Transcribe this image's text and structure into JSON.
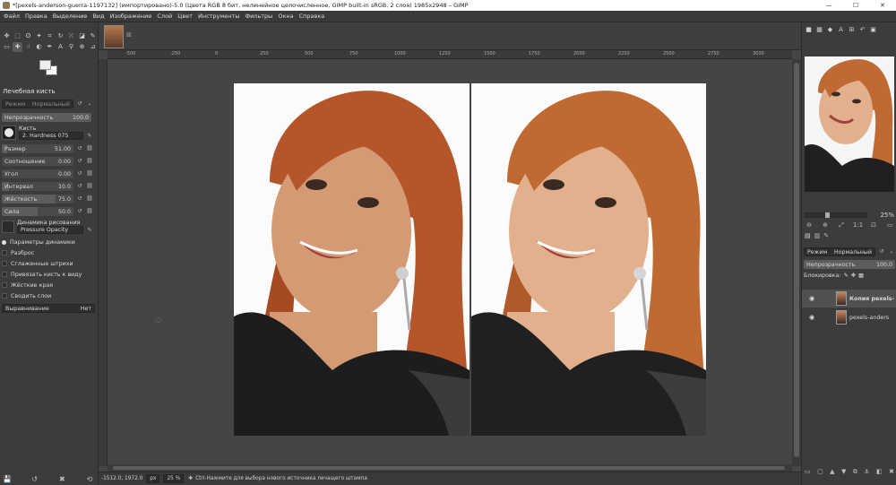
{
  "window": {
    "title": "*[pexels-anderson-guerra-1197132] (импортировано)-5.0 (Цвета RGB 8 бит, нелинейное целочисленное, GIMP built-in sRGB, 2 слоя) 1985x2948 – GIMP",
    "minimize": "—",
    "maximize": "☐",
    "close": "✕"
  },
  "menu": [
    "Файл",
    "Правка",
    "Выделение",
    "Вид",
    "Изображение",
    "Слой",
    "Цвет",
    "Инструменты",
    "Фильтры",
    "Окна",
    "Справка"
  ],
  "toolbox": {
    "tools": [
      {
        "icon": "move-icon",
        "glyph": "✥",
        "active": false
      },
      {
        "icon": "rect-select-icon",
        "glyph": "⬚",
        "active": false
      },
      {
        "icon": "lasso-icon",
        "glyph": "ʘ",
        "active": false
      },
      {
        "icon": "fuzzy-select-icon",
        "glyph": "✦",
        "active": false
      },
      {
        "icon": "crop-icon",
        "glyph": "⌗",
        "active": false
      },
      {
        "icon": "rotate-icon",
        "glyph": "↻",
        "active": false
      },
      {
        "icon": "warp-icon",
        "glyph": "⤫",
        "active": false
      },
      {
        "icon": "bucket-fill-icon",
        "glyph": "◪",
        "active": false
      },
      {
        "icon": "paintbrush-icon",
        "glyph": "✎",
        "active": false
      },
      {
        "icon": "eraser-icon",
        "glyph": "▭",
        "active": false
      },
      {
        "icon": "heal-icon",
        "glyph": "✚",
        "active": true
      },
      {
        "icon": "smudge-icon",
        "glyph": "☝",
        "active": false
      },
      {
        "icon": "dodge-icon",
        "glyph": "◐",
        "active": false
      },
      {
        "icon": "path-icon",
        "glyph": "✒",
        "active": false
      },
      {
        "icon": "text-icon",
        "glyph": "A",
        "active": false
      },
      {
        "icon": "color-picker-icon",
        "glyph": "⚲",
        "active": false
      },
      {
        "icon": "zoom-icon",
        "glyph": "⊕",
        "active": false
      },
      {
        "icon": "measure-icon",
        "glyph": "⊿",
        "active": false
      }
    ],
    "options_title": "Лечебная кисть",
    "mode_label": "Режим",
    "mode_value": "Нормальный",
    "opacity_label": "Непрозрачность",
    "opacity_value": "100.0",
    "brush_label": "Кисть",
    "brush_value": "2. Hardness 075",
    "size_label": "Размер",
    "size_value": "51.00",
    "aspect_label": "Соотношение",
    "aspect_value": "0.00",
    "angle_label": "Угол",
    "angle_value": "0.00",
    "spacing_label": "Интервал",
    "spacing_value": "10.0",
    "hardness_label": "Жёсткость",
    "hardness_value": "75.0",
    "force_label": "Сила",
    "force_value": "50.0",
    "dynamics_label": "Динамика рисования",
    "dynamics_value": "Pressure Opacity",
    "dynamics_options": "Параметры динамики",
    "jitter": "Разброс",
    "smooth": "Сглаженные штрихи",
    "lock_brush": "Привязать кисть к виду",
    "hard_edge": "Жёсткие края",
    "sample_merged": "Сводить слои",
    "alignment_label": "Выравнивание",
    "alignment_value": "Нет"
  },
  "ruler": {
    "ticks": [
      "-500",
      "-250",
      "0",
      "250",
      "500",
      "750",
      "1000",
      "1250",
      "1500",
      "1750",
      "2000",
      "2250",
      "2500",
      "2750",
      "3000"
    ]
  },
  "statusbar": {
    "coords": "-1512.0, 1972.0",
    "unit": "px",
    "zoom": "25 %",
    "message": "Ctrl-Нажмите для выбора нового источника лечащего штампа"
  },
  "right_dock": {
    "zoom_value": "25%",
    "mode_label": "Режим",
    "mode_value": "Нормальный",
    "opacity_label": "Непрозрачность",
    "opacity_value": "100.0",
    "lock_label": "Блокировка:",
    "layers": [
      {
        "name": "Копия pexels-",
        "bold": true
      },
      {
        "name": "pexels-anders",
        "bold": false
      }
    ]
  },
  "colors": {
    "panel_bg": "#3c3c3c",
    "canvas_bg": "#454545",
    "hair": "#b5542a",
    "skin": "#d9a07c",
    "shirt": "#1c1c1c"
  }
}
